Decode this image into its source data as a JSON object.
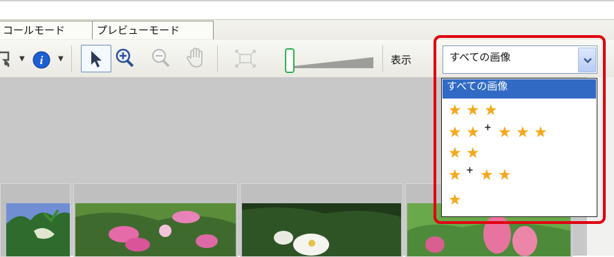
{
  "tabs": {
    "scroll_mode": "コールモード",
    "preview_mode": "プレビューモード"
  },
  "toolbar": {
    "show_label": "表示",
    "icons": [
      "send-icon",
      "info-icon",
      "pointer-icon",
      "zoom-in-icon",
      "zoom-out-icon",
      "hand-icon",
      "fit-icon"
    ]
  },
  "filter": {
    "selected": "すべての画像",
    "options": [
      {
        "label": "すべての画像",
        "selected": true
      },
      {
        "label": "3 stars",
        "stars": 3
      },
      {
        "label": "2 stars + 3 stars",
        "stars": [
          2,
          3
        ]
      },
      {
        "label": "2 stars",
        "stars": 2
      },
      {
        "label": "1 star + 2 stars",
        "stars": [
          1,
          2
        ]
      },
      {
        "label": "1 star",
        "stars": 1
      }
    ]
  },
  "colors": {
    "accent_selected": "#316ac5",
    "star": "#f4a81c",
    "highlight": "#e00010",
    "slider_knob": "#2fb24b"
  }
}
